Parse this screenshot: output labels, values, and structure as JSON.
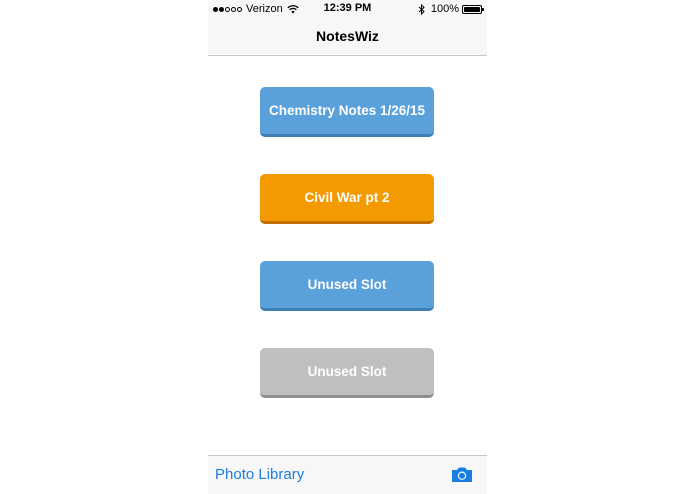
{
  "status_bar": {
    "carrier": "Verizon",
    "time": "12:39 PM",
    "battery": "100%",
    "signal_bars_filled": 2,
    "signal_bars_total": 5
  },
  "nav": {
    "title": "NotesWiz"
  },
  "slots": [
    {
      "label": "Chemistry Notes 1/26/15",
      "color": "#5aa1dc"
    },
    {
      "label": "Civil War pt 2",
      "color": "#f39a00"
    },
    {
      "label": "Unused Slot",
      "color": "#5aa1dc"
    },
    {
      "label": "Unused Slot",
      "color": "#bfbfbf"
    }
  ],
  "toolbar": {
    "photo_library_label": "Photo Library",
    "camera_icon": "camera-icon"
  },
  "colors": {
    "accent": "#1a7ee0",
    "bar_background": "#f7f7f7"
  }
}
